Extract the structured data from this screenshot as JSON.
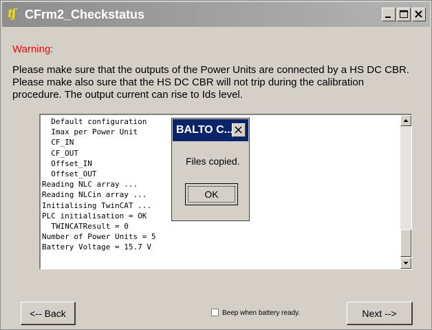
{
  "window": {
    "title": "CFrm2_Checkstatus",
    "app_icon": "ʧ",
    "minimize_glyph": "_",
    "maximize_glyph": "□",
    "close_glyph": "✕"
  },
  "warning": {
    "label": "Warning:"
  },
  "instructions": [
    "Please make sure that the outputs of the Power Units are connected by a HS DC CBR.",
    "Please make also sure that the HS DC CBR will not trip during the calibration",
    "procedure. The output current can rise to Ids level."
  ],
  "log": {
    "lines": [
      "  Default configuration",
      "  Imax per Power Unit",
      "  CF_IN",
      "  CF_OUT",
      "  Offset_IN",
      "  Offset_OUT",
      "Reading NLC array ...",
      "Reading NLCin array ...",
      "Initialising TwinCAT ...",
      "PLC initialisation = OK",
      "  TWINCATResult = 0",
      "Number of Power Units = 5",
      "Battery Voltage = 15.7 V"
    ]
  },
  "dialog": {
    "title": "BALTO C...",
    "close_glyph": "✕",
    "message": "Files copied.",
    "ok_label": "OK"
  },
  "footer": {
    "back_label": "<-- Back",
    "next_label": "Next -->",
    "beep_label": "Beep when battery ready.",
    "beep_checked": false
  }
}
